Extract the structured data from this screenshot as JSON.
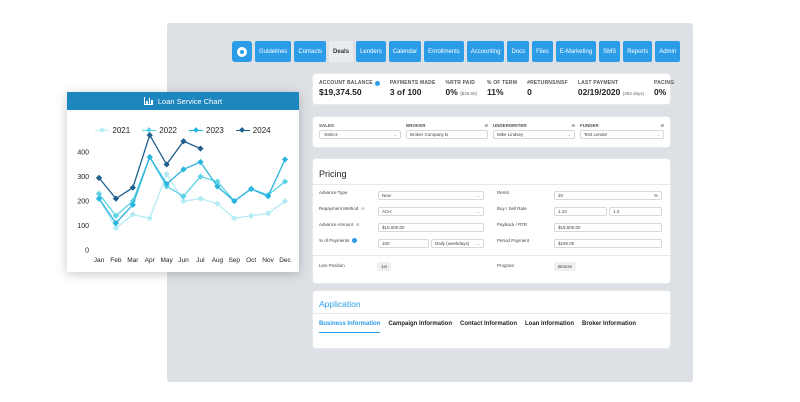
{
  "nav": {
    "items": [
      "Guidelines",
      "Contacts",
      "Deals",
      "Lenders",
      "Calendar",
      "Enrollments",
      "Accounting",
      "Docs",
      "Files",
      "E-Marketing",
      "SMS",
      "Reports",
      "Admin"
    ],
    "active": "Deals",
    "logo_icon": "circle-logo-icon"
  },
  "stats": {
    "account_balance_label": "ACCOUNT BALANCE",
    "account_balance_value": "$19,374.50",
    "payments_made_label": "PAYMENTS MADE",
    "payments_made_value": "3 of 100",
    "rtr_paid_label": "%RTR PAID",
    "rtr_paid_value": "0%",
    "rtr_paid_sub": "($45.50)",
    "of_term_label": "% OF TERM",
    "of_term_value": "11%",
    "returns_label": "#RETURNS/NSF",
    "returns_value": "0",
    "last_payment_label": "LAST PAYMENT",
    "last_payment_value": "02/19/2020",
    "last_payment_sub": "(483 days)",
    "pacing_label": "PACING",
    "pacing_value": "0%"
  },
  "assignments": {
    "sales_label": "SALES",
    "sales_value": "-Select-",
    "broker_label": "BROKER",
    "broker_value": "Broker Company B",
    "underwriter_label": "UNDERWRITER",
    "underwriter_value": "Mike Lindsey",
    "funder_label": "FUNDER",
    "funder_value": "Test Lender"
  },
  "pricing": {
    "title": "Pricing",
    "advance_type_label": "Advance Type",
    "advance_type_value": "New",
    "repayment_method_label": "Repayment Method",
    "repayment_method_value": "ACH",
    "advance_amount_label": "Advance Amount",
    "advance_amount_value": "$10,000.00",
    "pct_payments_label": "% of Payments",
    "pct_payments_value": "100",
    "pct_payments_freq": "Daily (weekdays)",
    "remit_label": "Remit",
    "remit_value": "20",
    "remit_unit": "%",
    "buy_sell_label": "Buy / Sell Rate",
    "buy_value": "1.10",
    "sell_value": "1.3",
    "payback_label": "Payback / RTR",
    "payback_value": "$19,500.00",
    "period_payment_label": "Period Payment",
    "period_payment_value": "$195.00",
    "lien_position_label": "Lien Position",
    "lien_position_value": "1st",
    "program_label": "Program",
    "program_value": "Bronze"
  },
  "application": {
    "title": "Application",
    "tabs": [
      "Business Information",
      "Campaign Information",
      "Contact Information",
      "Loan Information",
      "Broker Information"
    ],
    "active": "Business Information"
  },
  "chart_header": {
    "title": "Loan Service Chart",
    "icon": "bar-chart-icon"
  },
  "chart_data": {
    "type": "line",
    "title": "Loan Service Chart",
    "categories": [
      "Jan",
      "Feb",
      "Mar",
      "Apr",
      "May",
      "Jun",
      "Jul",
      "Aug",
      "Sep",
      "Oct",
      "Nov",
      "Dec"
    ],
    "yticks": [
      0,
      100,
      200,
      300,
      400
    ],
    "ylim": [
      0,
      450
    ],
    "legend_position": "top",
    "grid": false,
    "series": [
      {
        "name": "2021",
        "color": "#b3ecf4",
        "values": [
          210,
          90,
          145,
          130,
          310,
          200,
          210,
          190,
          130,
          140,
          150,
          200
        ]
      },
      {
        "name": "2022",
        "color": "#5fd3e6",
        "values": [
          230,
          140,
          200,
          380,
          260,
          220,
          300,
          280,
          200,
          250,
          225,
          280
        ]
      },
      {
        "name": "2023",
        "color": "#2ab5de",
        "values": [
          210,
          110,
          185,
          380,
          270,
          330,
          360,
          260,
          200,
          250,
          220,
          370
        ]
      },
      {
        "name": "2024",
        "color": "#1e5f8e",
        "values": [
          295,
          210,
          255,
          470,
          350,
          445,
          415,
          null,
          null,
          null,
          null,
          null
        ]
      }
    ]
  }
}
